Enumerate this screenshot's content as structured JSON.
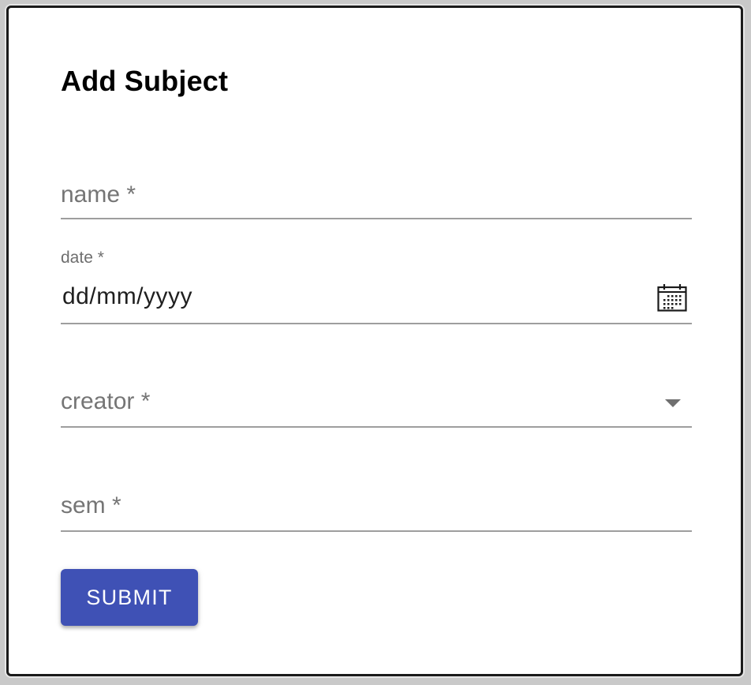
{
  "dialog": {
    "title": "Add Subject"
  },
  "form": {
    "name_field": {
      "placeholder": "name *",
      "value": ""
    },
    "date_field": {
      "label": "date *",
      "value": "dd/mm/yyyy",
      "icon": "calendar-icon"
    },
    "creator_field": {
      "placeholder": "creator *",
      "selected": "",
      "icon": "chevron-down-icon"
    },
    "sem_field": {
      "placeholder": "sem *",
      "value": ""
    },
    "submit_label": "SUBMIT"
  },
  "colors": {
    "primary": "#3f51b5",
    "underline": "#9e9e9e",
    "placeholder": "#757575"
  }
}
